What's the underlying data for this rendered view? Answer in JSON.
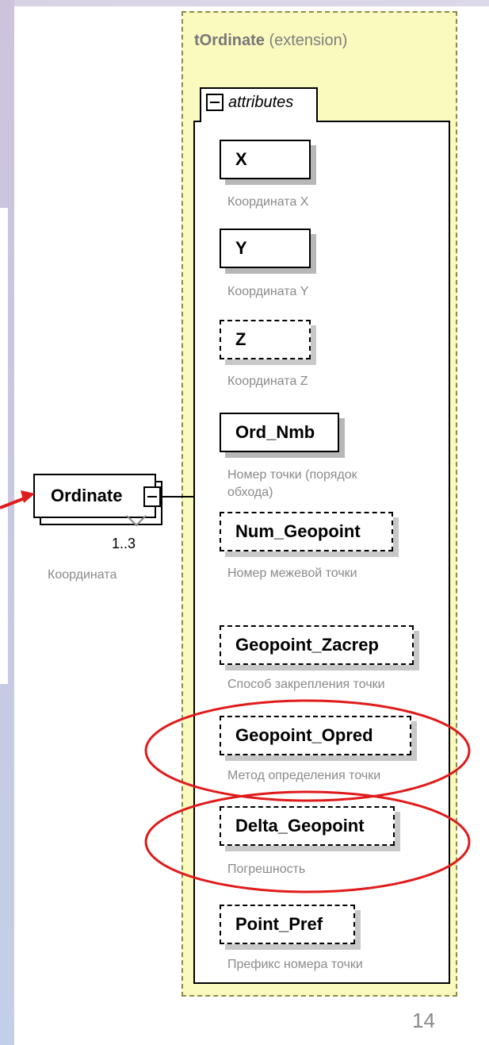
{
  "extension": {
    "name": "tOrdinate",
    "suffix": "(extension)",
    "compositor_label": "attributes"
  },
  "element": {
    "name": "Ordinate",
    "cardinality": "1..3",
    "doc": "Координата"
  },
  "attributes": [
    {
      "name": "X",
      "doc": "Координата X",
      "use": "required"
    },
    {
      "name": "Y",
      "doc": "Координата Y",
      "use": "required"
    },
    {
      "name": "Z",
      "doc": "Координата Z",
      "use": "optional"
    },
    {
      "name": "Ord_Nmb",
      "doc": "Номер точки (порядок",
      "doc2": "обхода)",
      "use": "required"
    },
    {
      "name": "Num_Geopoint",
      "doc": "Номер межевой точки",
      "use": "optional"
    },
    {
      "name": "Geopoint_Zacrep",
      "doc": "Способ закрепления точки",
      "use": "optional"
    },
    {
      "name": "Geopoint_Opred",
      "doc": "Метод определения точки",
      "use": "optional"
    },
    {
      "name": "Delta_Geopoint",
      "doc": "Погрешность",
      "use": "optional"
    },
    {
      "name": "Point_Pref",
      "doc": "Префикс номера точки",
      "use": "optional"
    }
  ],
  "highlights": [
    "Geopoint_Opred",
    "Delta_Geopoint"
  ],
  "colors": {
    "highlight": "#e01b1b",
    "container": "#fafabf"
  },
  "page_number": "14"
}
